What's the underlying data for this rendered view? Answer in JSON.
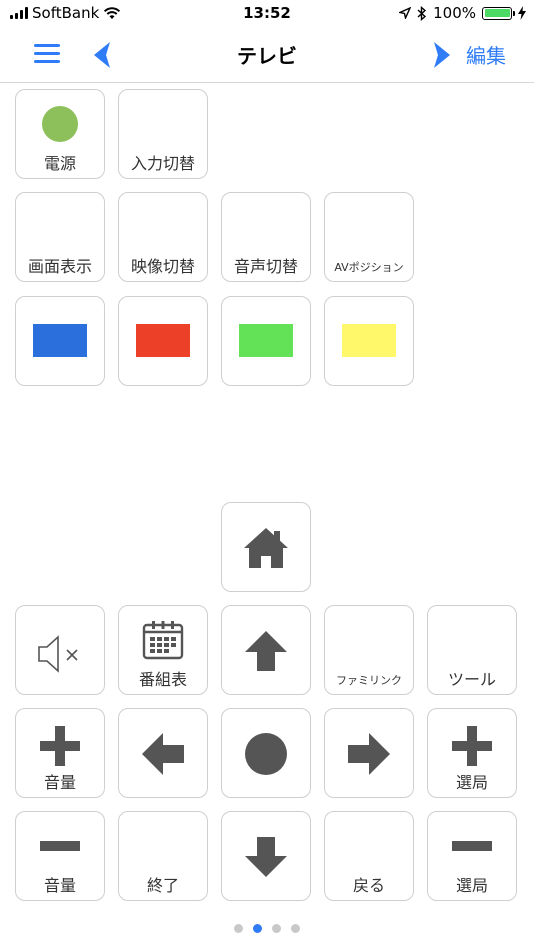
{
  "status": {
    "carrier": "SoftBank",
    "time": "13:52",
    "battery": "100%"
  },
  "nav": {
    "title": "テレビ",
    "edit_label": "編集"
  },
  "buttons": {
    "power": "電源",
    "input": "入力切替",
    "screen_display": "画面表示",
    "video_switch": "映像切替",
    "audio_switch": "音声切替",
    "av_position": "AVポジション",
    "epg": "番組表",
    "familink": "ファミリンク",
    "tool": "ツール",
    "vol_up": "音量",
    "ch_up": "選局",
    "vol_down": "音量",
    "exit": "終了",
    "back": "戻る",
    "ch_down": "選局"
  },
  "colors": {
    "accent": "#2f7cf6",
    "power_dot": "#8dc05a",
    "blue_key": "#2a6fdc",
    "red_key": "#ec4028",
    "green_key": "#63e258",
    "yellow_key": "#fff86a",
    "icon_gray": "#555555"
  },
  "icons": {
    "mute": "speaker-mute-icon",
    "epg": "calendar-icon",
    "home": "home-icon",
    "up": "arrow-up-icon",
    "down": "arrow-down-icon",
    "left": "arrow-left-icon",
    "right": "arrow-right-icon",
    "ok": "circle-ok-icon",
    "plus": "plus-icon",
    "minus": "minus-icon"
  },
  "pager": {
    "total_pages": 4,
    "current_page": 2
  }
}
